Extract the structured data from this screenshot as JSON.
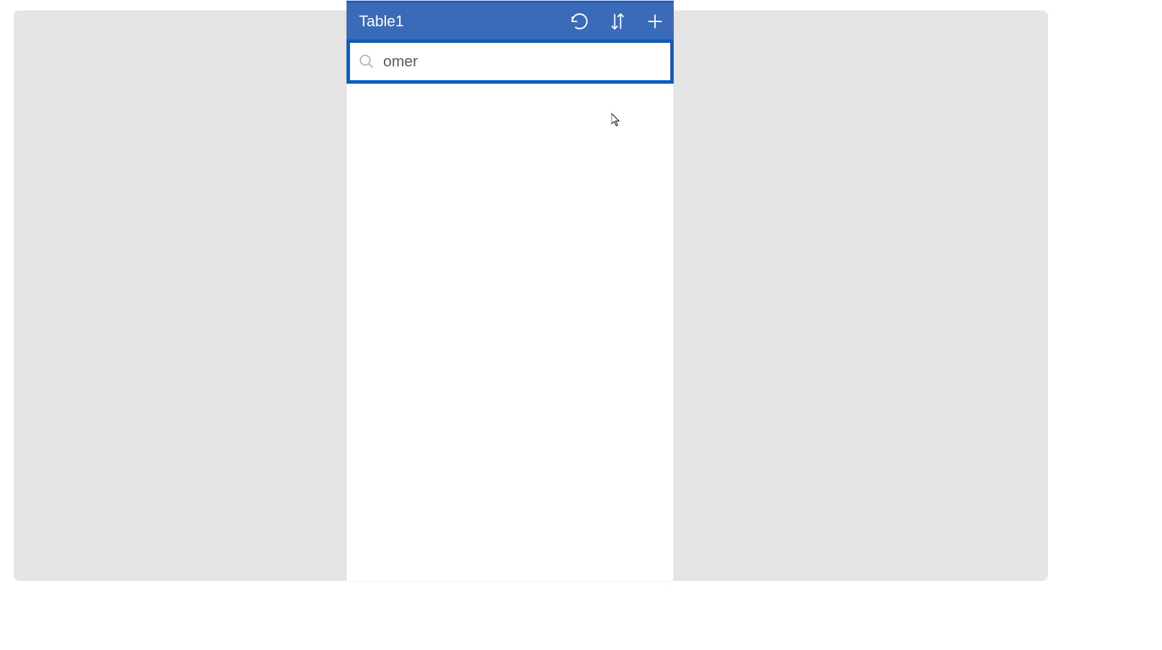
{
  "colors": {
    "header_bg": "#3a6bb8",
    "header_border_top": "#2b5aa8",
    "search_focus_border": "#0a5cc7",
    "page_bg": "#e5e5e5",
    "panel_bg": "#ffffff",
    "text_dark": "#5a5a5a"
  },
  "header": {
    "title": "Table1",
    "icons": {
      "refresh": "refresh-icon",
      "sort": "sort-icon",
      "add": "plus-icon"
    }
  },
  "search": {
    "value": "omer",
    "placeholder": "Search items"
  }
}
